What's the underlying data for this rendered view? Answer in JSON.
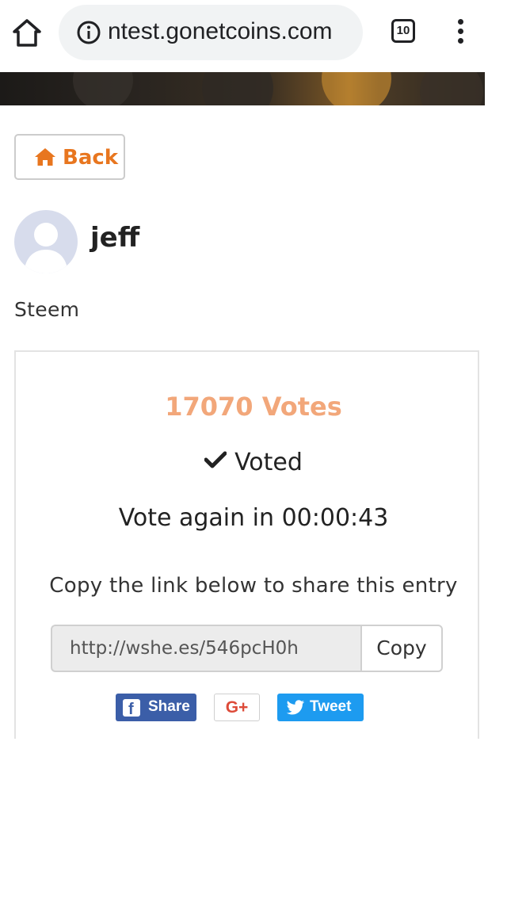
{
  "browser": {
    "url": "ntest.gonetcoins.com",
    "tab_count": "10"
  },
  "nav": {
    "back_label": "Back"
  },
  "profile": {
    "username": "jeff",
    "category": "Steem"
  },
  "entry": {
    "votes": "17070 Votes",
    "status": "Voted",
    "vote_again": "Vote again in 00:00:43",
    "share_hint": "Copy the link below to share this entry",
    "share_link": "http://wshe.es/546pcH0h",
    "copy_label": "Copy"
  },
  "social": {
    "facebook_label": "Share",
    "google_label": "G+",
    "twitter_label": "Tweet"
  },
  "colors": {
    "accent_orange": "#e8761f",
    "votes_color": "#f2a77a",
    "facebook_blue": "#3b5ea8",
    "twitter_blue": "#1d9bf0",
    "google_red": "#dd4b39"
  }
}
